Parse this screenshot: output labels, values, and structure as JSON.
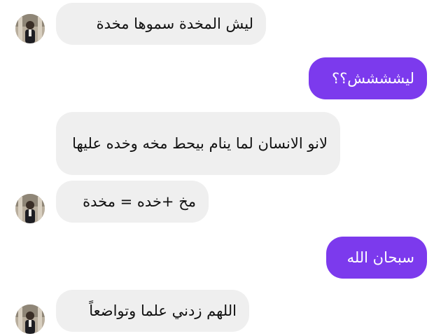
{
  "theme": {
    "incoming_bubble_color": "#efefef",
    "outgoing_bubble_color": "#7c3aed",
    "incoming_text_color": "#111111",
    "outgoing_text_color": "#ffffff"
  },
  "messages": [
    {
      "direction": "incoming",
      "show_avatar": true,
      "text": "ليش المخدة سموها مخدة"
    },
    {
      "direction": "outgoing",
      "show_avatar": false,
      "text": "ليشششش؟؟"
    },
    {
      "direction": "incoming",
      "show_avatar": false,
      "text": "لانو الانسان لما ينام بيحط مخه وخده عليها"
    },
    {
      "direction": "incoming",
      "show_avatar": true,
      "text": "مخ +خده = مخدة"
    },
    {
      "direction": "outgoing",
      "show_avatar": false,
      "text": "سبحان الله"
    },
    {
      "direction": "incoming",
      "show_avatar": true,
      "text": "اللهم زدني علما وتواضعاً"
    }
  ]
}
